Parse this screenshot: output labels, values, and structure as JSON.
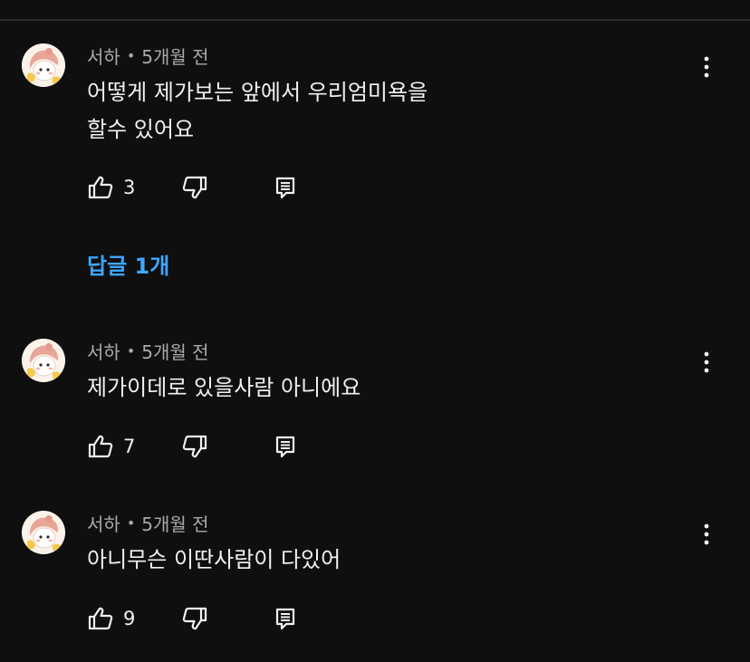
{
  "comments": [
    {
      "author": "서하",
      "separator": "•",
      "time": "5개월 전",
      "text": "어떻게 제가보는 앞에서 우리엄미욕을\n할수 있어요",
      "likes": "3"
    },
    {
      "author": "서하",
      "separator": "•",
      "time": "5개월 전",
      "text": "제가이데로 있을사람 아니에요",
      "likes": "7"
    },
    {
      "author": "서하",
      "separator": "•",
      "time": "5개월 전",
      "text": "아니무슨 이딴사람이 다있어",
      "likes": "9"
    }
  ],
  "replies_link": "답글 1개",
  "colors": {
    "background": "#0f0f0f",
    "text": "#f1f1f1",
    "meta": "#aaaaaa",
    "link": "#3ea6ff"
  },
  "icons": [
    "thumbs-up-icon",
    "thumbs-down-icon",
    "reply-icon",
    "more-vertical-icon"
  ]
}
